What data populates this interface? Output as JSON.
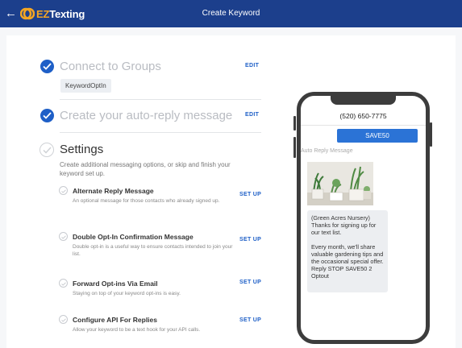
{
  "header": {
    "back_icon": "arrow-left-icon",
    "logo_icon": "ez-texting-logo-mark",
    "logo_ez": "EZ",
    "logo_texting": "Texting",
    "title": "Create Keyword",
    "background": "#1c3f8c"
  },
  "steps": {
    "connect": {
      "title": "Connect to Groups",
      "edit_label": "EDIT",
      "tag": "KeywordOptIn",
      "status": "complete"
    },
    "auto_reply": {
      "title": "Create your auto-reply message",
      "edit_label": "EDIT",
      "status": "complete"
    },
    "settings": {
      "title": "Settings",
      "description": "Create additional messaging options, or skip and finish your keyword set up.",
      "status": "incomplete"
    }
  },
  "options": [
    {
      "title": "Alternate Reply Message",
      "description": "An optional message for those contacts who already signed up.",
      "action": "SET UP"
    },
    {
      "title": "Double Opt-In Confirmation Message",
      "description": "Double opt-in is a useful way to ensure contacts intended to join your list.",
      "action": "SET UP"
    },
    {
      "title": "Forward Opt-ins Via Email",
      "description": "Staying on top of your keyword opt-ins is easy.",
      "action": "SET UP"
    },
    {
      "title": "Configure API For Replies",
      "description": "Allow your keyword to be a text hook for your API calls.",
      "action": "SET UP"
    }
  ],
  "phone": {
    "number": "(520) 650-7775",
    "outgoing": "SAVE50",
    "auto_reply_label": "Auto Reply Message",
    "photo_icon": "plants-photo",
    "reply_text": "(Green Acres Nursery)\nThanks for signing up for our text list.\n\nEvery month, we'll share valuable gardening tips and the occasional special offer. Reply STOP SAVE50 2 Optout"
  },
  "colors": {
    "accent": "#1e5fc7",
    "bubble_out": "#2b73d6"
  }
}
